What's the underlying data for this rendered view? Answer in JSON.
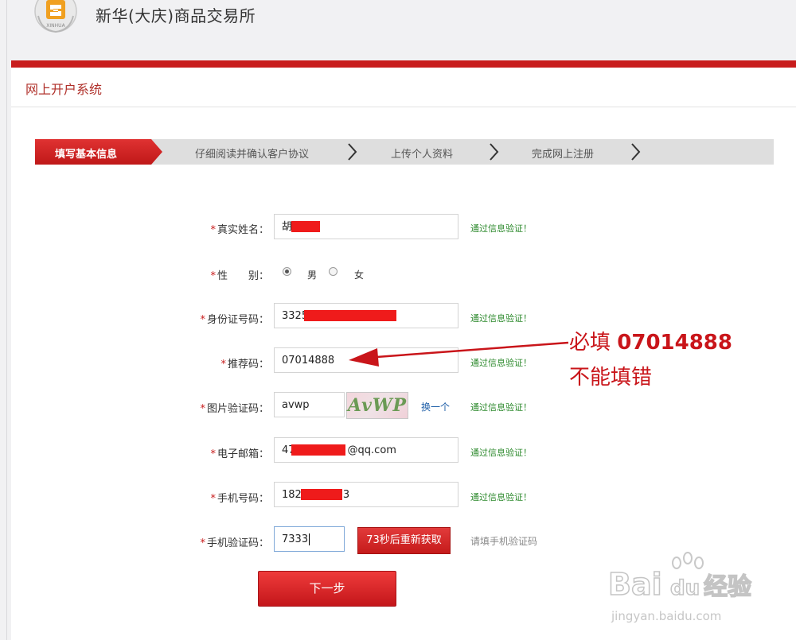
{
  "header": {
    "site_title": "新华(大庆)商品交易所"
  },
  "system": {
    "title": "网上开户系统"
  },
  "steps": [
    {
      "label": "填写基本信息",
      "active": true
    },
    {
      "label": "仔细阅读并确认客户协议",
      "active": false
    },
    {
      "label": "上传个人资料",
      "active": false
    },
    {
      "label": "完成网上注册",
      "active": false
    }
  ],
  "form": {
    "required_mark": "*",
    "verified_text": "通过信息验证！",
    "name": {
      "label": "真实姓名：",
      "value": "胡"
    },
    "gender": {
      "label": "性　　别：",
      "male": "男",
      "female": "女",
      "selected": "男"
    },
    "id_number": {
      "label": "身份证号码：",
      "value": "3325"
    },
    "referral": {
      "label": "推荐码：",
      "value": "07014888"
    },
    "captcha": {
      "label": "图片验证码：",
      "value": "avwp",
      "image_text": "AvWP",
      "change_link": "换一个"
    },
    "email": {
      "label": "电子邮箱：",
      "prefix": "47",
      "suffix": "@qq.com"
    },
    "phone": {
      "label": "手机号码：",
      "prefix": "182",
      "suffix": "3"
    },
    "sms_code": {
      "label": "手机验证码：",
      "value": "7333",
      "resend_button": "73秒后重新获取",
      "hint": "请填手机验证码"
    },
    "next_button": "下一步"
  },
  "annotation": {
    "line1_prefix": "必填 ",
    "line1_code": "07014888",
    "line2": "不能填错"
  },
  "watermark": {
    "brand": "Bai",
    "brand2": "du",
    "product": "经验",
    "url": "jingyan.baidu.com"
  },
  "colors": {
    "brand_red": "#c81c1c",
    "verified_green": "#2d8a2d",
    "link_blue": "#1f5fa8"
  }
}
